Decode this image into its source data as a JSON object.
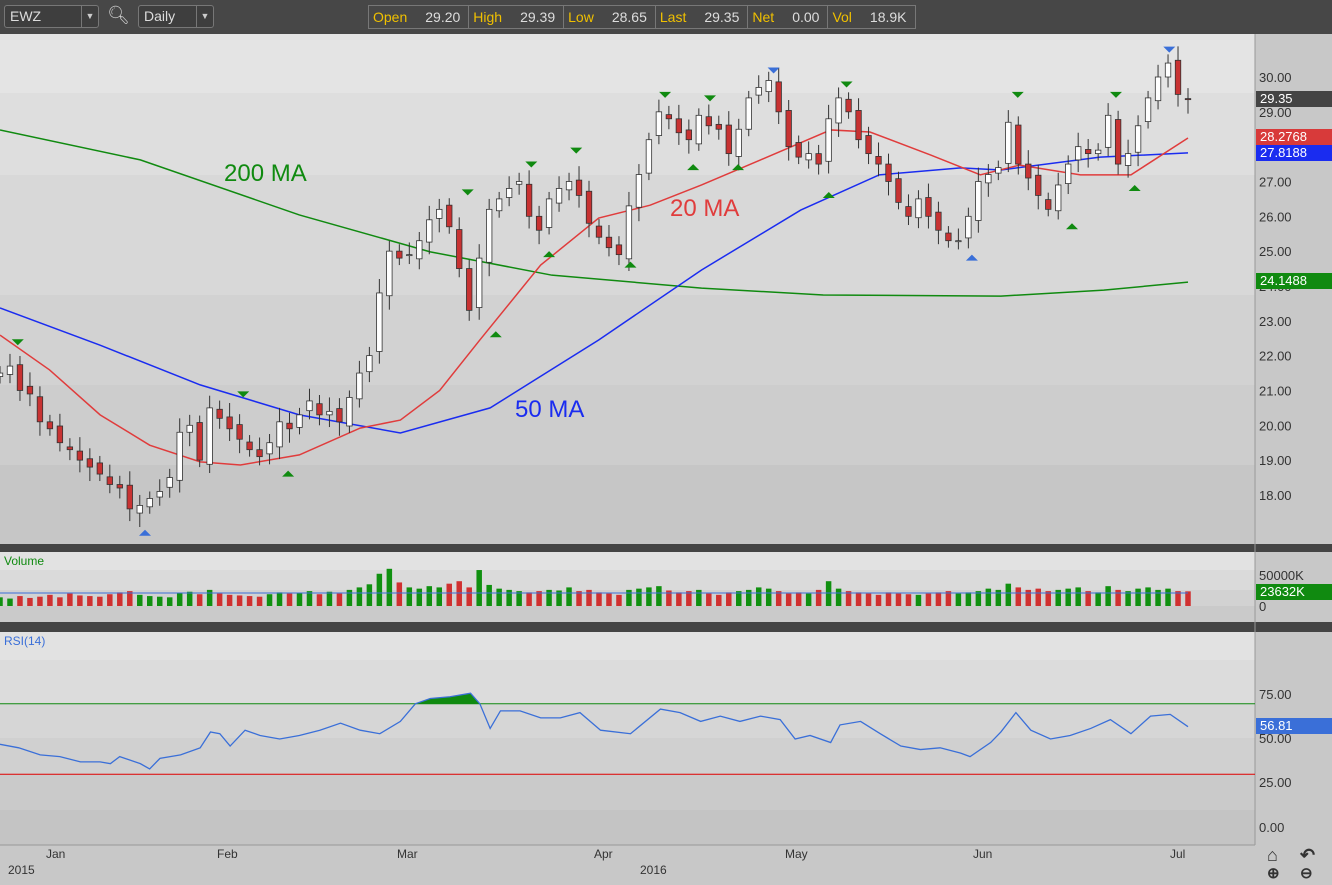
{
  "toolbar": {
    "symbol": "EWZ",
    "interval": "Daily",
    "quote": [
      {
        "k": "Open",
        "v": "29.20"
      },
      {
        "k": "High",
        "v": "29.39"
      },
      {
        "k": "Low",
        "v": "28.65"
      },
      {
        "k": "Last",
        "v": "29.35"
      },
      {
        "k": "Net",
        "v": "0.00"
      },
      {
        "k": "Vol",
        "v": "18.9K"
      }
    ]
  },
  "price_axis": [
    "30.00",
    "29.00",
    "28.00",
    "27.00",
    "26.00",
    "25.00",
    "24.00",
    "23.00",
    "22.00",
    "21.00",
    "20.00",
    "19.00",
    "18.00"
  ],
  "badges": {
    "last": "29.35",
    "ma20": "28.2768",
    "ma50": "27.8188",
    "ma200": "24.1488",
    "volume": "23632K",
    "rsi": "56.81"
  },
  "labels": {
    "ma200": "200 MA",
    "ma20": "20 MA",
    "ma50": "50 MA",
    "volume": "Volume",
    "rsi": "RSI(14)"
  },
  "volume_axis": {
    "top": "50000K",
    "zero": "0"
  },
  "rsi_axis": [
    "75.00",
    "50.00",
    "25.00",
    "0.00"
  ],
  "months": [
    "Jan",
    "Feb",
    "Mar",
    "Apr",
    "May",
    "Jun",
    "Jul"
  ],
  "years": [
    "2015",
    "2016"
  ],
  "colors": {
    "up": "#ffffff",
    "down": "#c83232",
    "ma20": "#e03c3c",
    "ma50": "#1a2cf0",
    "ma200": "#108a10",
    "vol_up": "#109010",
    "vol_down": "#d03030",
    "rsi": "#3a6fd8"
  },
  "chart_data": {
    "type": "candlestick",
    "closes": [
      21.5,
      21.7,
      21.0,
      20.9,
      20.1,
      19.9,
      19.5,
      19.3,
      19.0,
      18.8,
      18.6,
      18.3,
      18.2,
      17.6,
      17.7,
      17.9,
      18.1,
      18.5,
      19.8,
      20.0,
      19.0,
      20.5,
      20.2,
      19.9,
      19.6,
      19.3,
      19.1,
      19.5,
      20.1,
      19.9,
      20.3,
      20.7,
      20.3,
      20.4,
      20.1,
      20.8,
      21.5,
      22.0,
      23.8,
      25.0,
      24.8,
      24.9,
      25.3,
      25.9,
      26.2,
      25.7,
      24.5,
      23.3,
      24.8,
      26.2,
      26.5,
      26.8,
      27.0,
      26.0,
      25.6,
      26.5,
      26.8,
      27.0,
      26.6,
      25.8,
      25.4,
      25.1,
      24.9,
      26.3,
      27.2,
      28.2,
      29.0,
      28.8,
      28.4,
      28.2,
      28.9,
      28.6,
      28.5,
      27.8,
      28.5,
      29.4,
      29.7,
      29.9,
      29.0,
      28.0,
      27.7,
      27.8,
      27.5,
      28.8,
      29.4,
      29.0,
      28.2,
      27.8,
      27.5,
      27.0,
      26.4,
      26.0,
      26.5,
      26.0,
      25.6,
      25.3,
      25.3,
      26.0,
      27.0,
      27.2,
      27.4,
      28.7,
      27.5,
      27.1,
      26.6,
      26.2,
      26.9,
      27.5,
      28.0,
      27.8,
      27.9,
      28.9,
      27.5,
      27.8,
      28.6,
      29.4,
      30.0,
      30.4,
      29.5,
      29.35
    ],
    "volumes_k": [
      14000,
      12000,
      16000,
      13000,
      15000,
      18000,
      14000,
      20000,
      17000,
      16000,
      15000,
      19000,
      22000,
      24000,
      18000,
      16000,
      15000,
      14000,
      21000,
      23000,
      19000,
      26000,
      20000,
      18000,
      17000,
      16000,
      15000,
      19000,
      22000,
      20000,
      21000,
      24000,
      19000,
      23000,
      20000,
      26000,
      30000,
      35000,
      52000,
      60000,
      38000,
      30000,
      28000,
      32000,
      30000,
      36000,
      40000,
      30000,
      58000,
      34000,
      28000,
      26000,
      24000,
      22000,
      24000,
      26000,
      25000,
      30000,
      24000,
      26000,
      22000,
      20000,
      18000,
      26000,
      28000,
      30000,
      32000,
      25000,
      22000,
      24000,
      26000,
      20000,
      18000,
      22000,
      24000,
      26000,
      30000,
      28000,
      24000,
      20000,
      22000,
      20000,
      26000,
      40000,
      28000,
      24000,
      22000,
      20000,
      18000,
      22000,
      20000,
      19000,
      18000,
      20000,
      22000,
      24000,
      20000,
      22000,
      24000,
      28000,
      26000,
      36000,
      30000,
      26000,
      28000,
      24000,
      26000,
      28000,
      30000,
      24000,
      22000,
      32000,
      26000,
      24000,
      28000,
      30000,
      26000,
      28000,
      24000,
      23632
    ],
    "ma200": [
      [
        0,
        28.48
      ],
      [
        15,
        27.62
      ],
      [
        32,
        26.04
      ],
      [
        46,
        24.98
      ],
      [
        59,
        24.31
      ],
      [
        75,
        23.94
      ],
      [
        88,
        23.74
      ],
      [
        107,
        23.71
      ],
      [
        118,
        23.88
      ],
      [
        127,
        24.11
      ]
    ],
    "ma50": [
      [
        0,
        23.37
      ],
      [
        10.7,
        22.3
      ],
      [
        21.4,
        21.16
      ],
      [
        32,
        20.3
      ],
      [
        42.8,
        19.78
      ],
      [
        52.4,
        20.5
      ],
      [
        64,
        22.45
      ],
      [
        75,
        24.46
      ],
      [
        85.6,
        26.18
      ],
      [
        94,
        27.19
      ],
      [
        102.7,
        27.39
      ],
      [
        107,
        27.33
      ],
      [
        117.6,
        27.7
      ],
      [
        127,
        27.82
      ]
    ],
    "ma20": [
      [
        0,
        22.59
      ],
      [
        5.3,
        21.59
      ],
      [
        10.7,
        20.3
      ],
      [
        16,
        19.43
      ],
      [
        21.4,
        18.95
      ],
      [
        25.7,
        18.86
      ],
      [
        32,
        19.15
      ],
      [
        38.5,
        19.92
      ],
      [
        42.8,
        20.15
      ],
      [
        47,
        21.0
      ],
      [
        51.3,
        22.45
      ],
      [
        57.8,
        24.6
      ],
      [
        64,
        25.95
      ],
      [
        69.5,
        26.32
      ],
      [
        75,
        26.9
      ],
      [
        81.3,
        27.62
      ],
      [
        88.8,
        28.48
      ],
      [
        93,
        28.42
      ],
      [
        99.5,
        27.76
      ],
      [
        104.8,
        27.19
      ],
      [
        109,
        27.47
      ],
      [
        115.5,
        27.19
      ],
      [
        120.9,
        27.19
      ],
      [
        127,
        28.25
      ]
    ],
    "volume_ma_k": 21000,
    "rsi": [
      [
        0,
        47
      ],
      [
        2,
        45
      ],
      [
        4.3,
        41
      ],
      [
        6.4,
        40
      ],
      [
        8.6,
        37
      ],
      [
        10.7,
        37
      ],
      [
        11.8,
        36
      ],
      [
        12.8,
        40
      ],
      [
        15,
        36
      ],
      [
        16,
        33
      ],
      [
        17.1,
        39
      ],
      [
        19.3,
        41
      ],
      [
        21.4,
        45
      ],
      [
        22.5,
        54
      ],
      [
        23.5,
        53
      ],
      [
        24.6,
        46
      ],
      [
        26.2,
        55
      ],
      [
        27.8,
        52
      ],
      [
        29.9,
        50
      ],
      [
        32,
        52
      ],
      [
        34.2,
        55
      ],
      [
        36.4,
        59
      ],
      [
        38.5,
        55
      ],
      [
        40.6,
        53
      ],
      [
        42.8,
        60
      ],
      [
        44.4,
        70
      ],
      [
        46,
        73
      ],
      [
        48.1,
        74
      ],
      [
        50.3,
        76
      ],
      [
        51.3,
        70
      ],
      [
        52.4,
        56
      ],
      [
        53.5,
        66
      ],
      [
        55.6,
        66
      ],
      [
        57.8,
        62
      ],
      [
        59.9,
        62
      ],
      [
        62,
        65
      ],
      [
        64.2,
        55
      ],
      [
        67.4,
        53
      ],
      [
        70.6,
        67
      ],
      [
        72.7,
        65
      ],
      [
        74.9,
        60
      ],
      [
        77,
        63
      ],
      [
        79.1,
        60
      ],
      [
        81.3,
        63
      ],
      [
        83.4,
        61
      ],
      [
        85,
        50
      ],
      [
        86.6,
        52
      ],
      [
        88.8,
        48
      ],
      [
        89.8,
        58
      ],
      [
        92,
        60
      ],
      [
        94.1,
        53
      ],
      [
        96.3,
        46
      ],
      [
        98.4,
        44
      ],
      [
        100.5,
        45
      ],
      [
        102.7,
        42
      ],
      [
        103.7,
        40
      ],
      [
        105.9,
        48
      ],
      [
        107,
        54
      ],
      [
        108.6,
        65
      ],
      [
        110.2,
        55
      ],
      [
        112.3,
        50
      ],
      [
        114.4,
        52
      ],
      [
        116.6,
        56
      ],
      [
        118.7,
        61
      ],
      [
        120.9,
        53
      ],
      [
        123,
        63
      ],
      [
        125.1,
        64
      ],
      [
        127,
        57
      ]
    ],
    "rsi_levels": [
      70,
      30
    ],
    "markers": [
      [
        1.9,
        22.3,
        "high"
      ],
      [
        26,
        20.8,
        "high"
      ],
      [
        50,
        26.6,
        "high"
      ],
      [
        56.8,
        27.4,
        "high"
      ],
      [
        61.6,
        27.8,
        "high"
      ],
      [
        71.1,
        29.4,
        "high"
      ],
      [
        75.9,
        29.3,
        "high"
      ],
      [
        90.5,
        29.7,
        "high"
      ],
      [
        108.8,
        29.4,
        "high"
      ],
      [
        119.3,
        29.4,
        "high"
      ],
      [
        82.7,
        30.1,
        "peak"
      ],
      [
        125,
        30.7,
        "peak"
      ],
      [
        30.8,
        18.7,
        "low"
      ],
      [
        53,
        22.7,
        "low"
      ],
      [
        58.7,
        25.0,
        "low"
      ],
      [
        67.4,
        24.7,
        "low"
      ],
      [
        74.1,
        27.5,
        "low"
      ],
      [
        78.9,
        27.5,
        "low"
      ],
      [
        88.6,
        26.7,
        "low"
      ],
      [
        114.6,
        25.8,
        "low"
      ],
      [
        121.3,
        26.9,
        "low"
      ],
      [
        15.5,
        17.0,
        "trough"
      ],
      [
        103.9,
        24.9,
        "trough"
      ]
    ],
    "ylim": [
      16.9,
      31.3
    ]
  }
}
